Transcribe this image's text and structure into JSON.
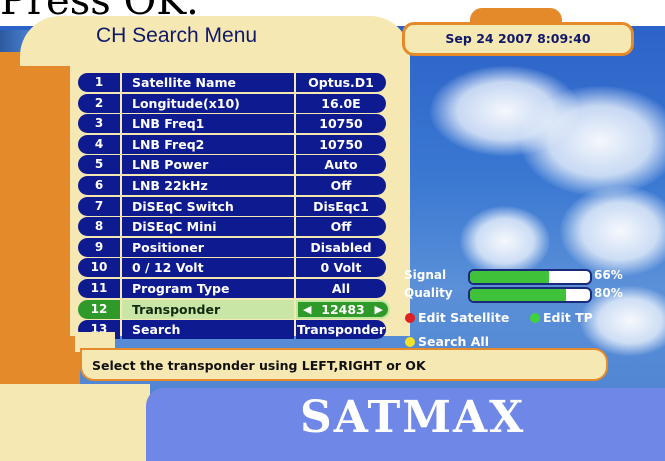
{
  "caption": "Press OK.",
  "menu": {
    "title": "CH Search Menu",
    "rows": [
      {
        "num": "1",
        "label": "Satellite Name",
        "value": "Optus.D1"
      },
      {
        "num": "2",
        "label": "Longitude(x10)",
        "value": "16.0E"
      },
      {
        "num": "3",
        "label": "LNB Freq1",
        "value": "10750"
      },
      {
        "num": "4",
        "label": "LNB Freq2",
        "value": "10750"
      },
      {
        "num": "5",
        "label": "LNB Power",
        "value": "Auto"
      },
      {
        "num": "6",
        "label": "LNB 22kHz",
        "value": "Off"
      },
      {
        "num": "7",
        "label": "DiSEqC Switch",
        "value": "DisEqc1"
      },
      {
        "num": "8",
        "label": "DiSEqC Mini",
        "value": "Off"
      },
      {
        "num": "9",
        "label": "Positioner",
        "value": "Disabled"
      },
      {
        "num": "10",
        "label": "0 / 12 Volt",
        "value": "0 Volt"
      },
      {
        "num": "11",
        "label": "Program Type",
        "value": "All"
      },
      {
        "num": "12",
        "label": "Transponder",
        "value": "12483",
        "selected": true
      },
      {
        "num": "13",
        "label": "Search",
        "value": "Transponder"
      }
    ]
  },
  "datetime": "Sep 24 2007 8:09:40",
  "signal": {
    "label": "Signal",
    "percent_text": "66%",
    "level": 0.66
  },
  "quality": {
    "label": "Quality",
    "percent_text": "80%",
    "level": 0.8
  },
  "legend": {
    "edit_satellite": "Edit Satellite",
    "edit_tp": "Edit TP",
    "search_all": "Search All"
  },
  "help_text": "Select the transponder using LEFT,RIGHT or OK",
  "brand": "SATMAX",
  "colors": {
    "red_key": "#e02020",
    "green_key": "#3fd23a",
    "yellow_key": "#f2e22a"
  }
}
